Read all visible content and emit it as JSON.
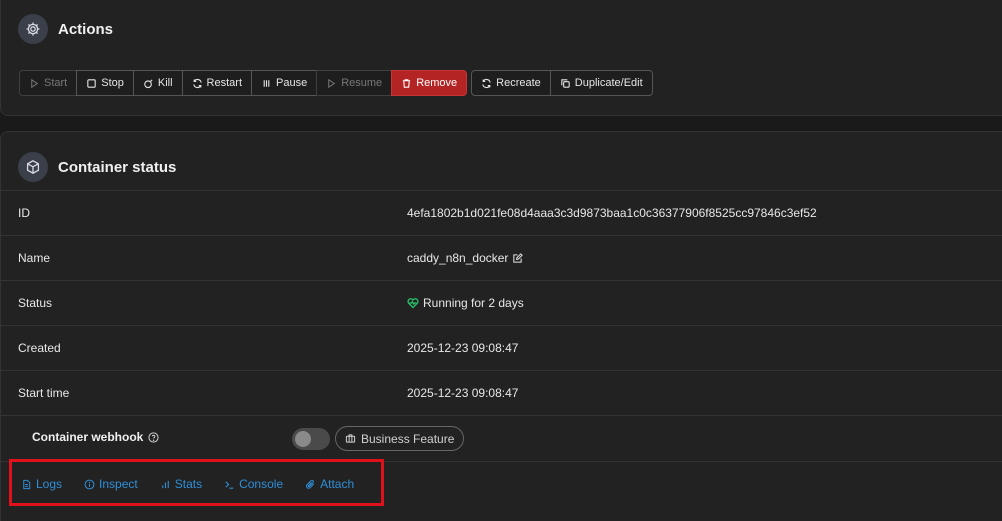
{
  "actions": {
    "title": "Actions",
    "icon": "gear-icon",
    "buttons": {
      "start": "Start",
      "stop": "Stop",
      "kill": "Kill",
      "restart": "Restart",
      "pause": "Pause",
      "resume": "Resume",
      "remove": "Remove",
      "recreate": "Recreate",
      "duplicate_edit": "Duplicate/Edit"
    }
  },
  "status": {
    "title": "Container status",
    "icon": "cube-icon",
    "rows": {
      "id_label": "ID",
      "id_value": "4efa1802b1d021fe08d4aaa3c3d9873baa1c0c36377906f8525cc97846c3ef52",
      "name_label": "Name",
      "name_value": "caddy_n8n_docker",
      "status_label": "Status",
      "status_value": "Running for 2 days",
      "created_label": "Created",
      "created_value": "2025-12-23 09:08:47",
      "start_label": "Start time",
      "start_value": "2025-12-23 09:08:47"
    },
    "webhook": {
      "label": "Container webhook",
      "badge": "Business Feature",
      "enabled": false
    },
    "links": {
      "logs": "Logs",
      "inspect": "Inspect",
      "stats": "Stats",
      "console": "Console",
      "attach": "Attach"
    }
  },
  "colors": {
    "background": "#1a1a1a",
    "panel": "#222222",
    "danger": "#b42424",
    "link": "#2e8fd8",
    "running": "#2bc46a",
    "highlight": "#e0111b"
  }
}
